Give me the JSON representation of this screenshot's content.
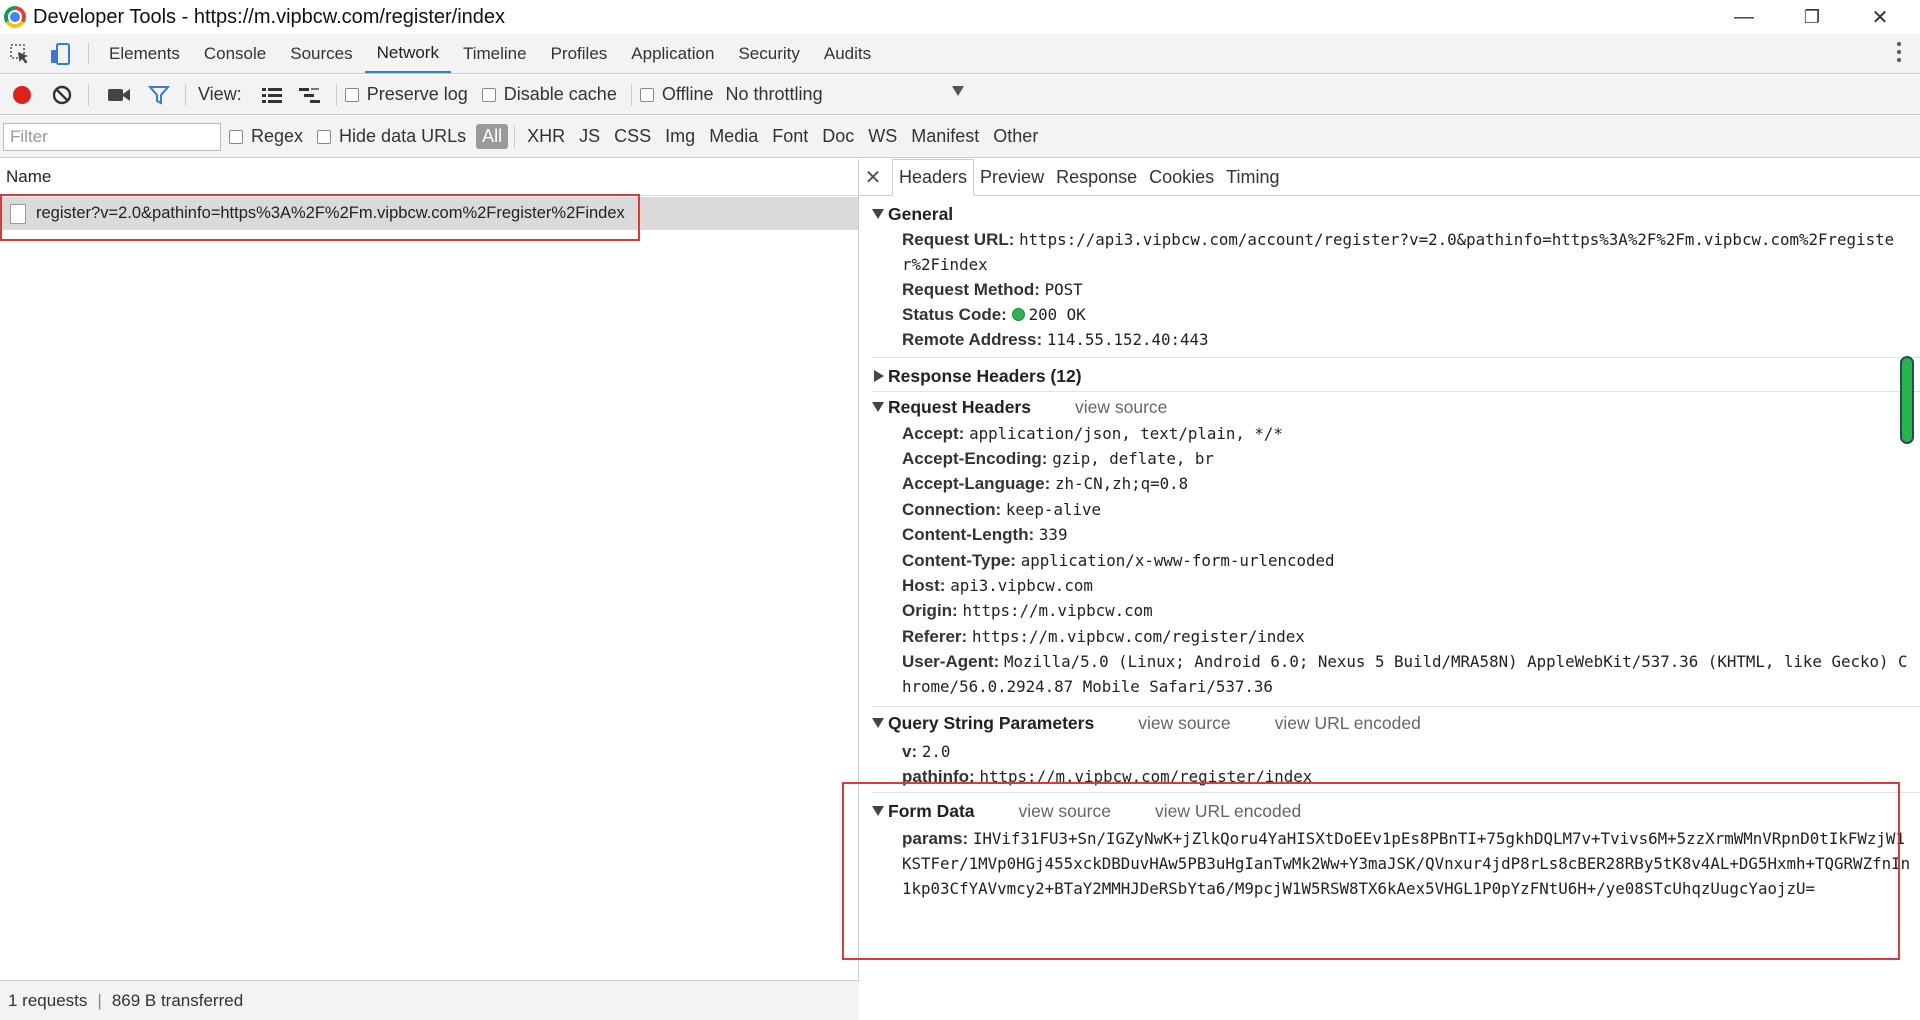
{
  "window": {
    "title": "Developer Tools - https://m.vipbcw.com/register/index",
    "controls": {
      "minimize": "—",
      "restore": "❐",
      "close": "✕"
    }
  },
  "devtools_tabs": [
    "Elements",
    "Console",
    "Sources",
    "Network",
    "Timeline",
    "Profiles",
    "Application",
    "Security",
    "Audits"
  ],
  "active_devtools_tab": "Network",
  "toolbar": {
    "view_label": "View:",
    "preserve_log": "Preserve log",
    "disable_cache": "Disable cache",
    "offline": "Offline",
    "throttling": "No throttling",
    "record_color": "#e0211b",
    "filter_color": "#3879d9"
  },
  "filterbar": {
    "placeholder": "Filter",
    "regex": "Regex",
    "hide_data_urls": "Hide data URLs",
    "types": [
      "All",
      "XHR",
      "JS",
      "CSS",
      "Img",
      "Media",
      "Font",
      "Doc",
      "WS",
      "Manifest",
      "Other"
    ],
    "active_type": "All"
  },
  "request_list": {
    "column_name": "Name",
    "rows": [
      {
        "name": "register?v=2.0&pathinfo=https%3A%2F%2Fm.vipbcw.com%2Fregister%2Findex",
        "selected": true
      }
    ]
  },
  "status": {
    "requests": "1 requests",
    "transferred": "869 B transferred"
  },
  "detail_tabs": [
    "Headers",
    "Preview",
    "Response",
    "Cookies",
    "Timing"
  ],
  "active_detail_tab": "Headers",
  "general": {
    "title": "General",
    "request_url_label": "Request URL:",
    "request_url": "https://api3.vipbcw.com/account/register?v=2.0&pathinfo=https%3A%2F%2Fm.vipbcw.com%2Fregister%2Findex",
    "method_label": "Request Method:",
    "method": "POST",
    "status_label": "Status Code:",
    "status": "200 OK",
    "remote_label": "Remote Address:",
    "remote": "114.55.152.40:443"
  },
  "response_headers": {
    "title": "Response Headers (12)"
  },
  "request_headers": {
    "title": "Request Headers",
    "view_source": "view source",
    "items": [
      {
        "k": "Accept:",
        "v": "application/json, text/plain, */*"
      },
      {
        "k": "Accept-Encoding:",
        "v": "gzip, deflate, br"
      },
      {
        "k": "Accept-Language:",
        "v": "zh-CN,zh;q=0.8"
      },
      {
        "k": "Connection:",
        "v": "keep-alive"
      },
      {
        "k": "Content-Length:",
        "v": "339"
      },
      {
        "k": "Content-Type:",
        "v": "application/x-www-form-urlencoded"
      },
      {
        "k": "Host:",
        "v": "api3.vipbcw.com"
      },
      {
        "k": "Origin:",
        "v": "https://m.vipbcw.com"
      },
      {
        "k": "Referer:",
        "v": "https://m.vipbcw.com/register/index"
      },
      {
        "k": "User-Agent:",
        "v": "Mozilla/5.0 (Linux; Android 6.0; Nexus 5 Build/MRA58N) AppleWebKit/537.36 (KHTML, like Gecko) Chrome/56.0.2924.87 Mobile Safari/537.36"
      }
    ]
  },
  "query_params": {
    "title": "Query String Parameters",
    "view_source": "view source",
    "view_encoded": "view URL encoded",
    "items": [
      {
        "k": "v:",
        "v": "2.0"
      },
      {
        "k": "pathinfo:",
        "v": "https://m.vipbcw.com/register/index"
      }
    ]
  },
  "form_data": {
    "title": "Form Data",
    "view_source": "view source",
    "view_encoded": "view URL encoded",
    "params_label": "params:",
    "params": "IHVif31FU3+Sn/IGZyNwK+jZlkQoru4YaHISXtDoEEv1pEs8PBnTI+75gkhDQLM7v+Tvivs6M+5zzXrmWMnVRpnD0tIkFWzjW1KSTFer/1MVp0HGj455xckDBDuvHAw5PB3uHgIanTwMk2Ww+Y3maJSK/QVnxur4jdP8rLs8cBER28RBy5tK8v4AL+DG5Hxmh+TQGRWZfnIn1kp03CfYAVvmcy2+BTaY2MMHJDeRSbYta6/M9pcjW1W5RSW8TX6kAex5VHGL1P0pYzFNtU6H+/ye08STcUhqzUugcYaojzU="
  }
}
